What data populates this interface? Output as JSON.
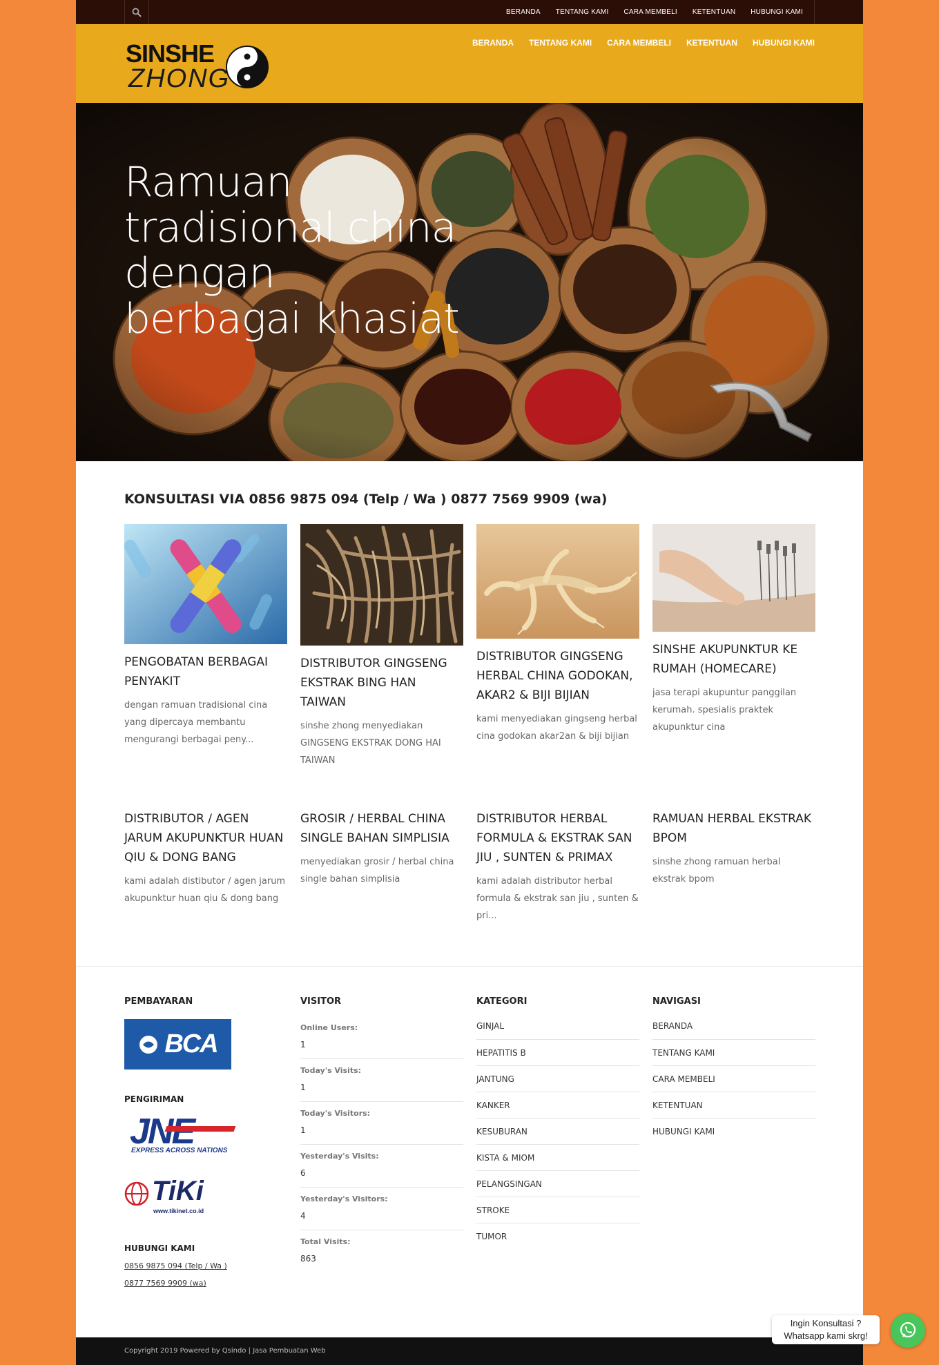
{
  "topbar": {
    "nav": [
      "BERANDA",
      "TENTANG KAMI",
      "CARA MEMBELI",
      "KETENTUAN",
      "HUBUNGI KAMI"
    ]
  },
  "header": {
    "logo_line1": "SINSHE",
    "logo_line2": "ZHONG",
    "nav": [
      "BERANDA",
      "TENTANG KAMI",
      "CARA MEMBELI",
      "KETENTUAN",
      "HUBUNGI KAMI"
    ]
  },
  "hero": {
    "line1": "Ramuan",
    "line2": "tradisional china",
    "line3": "dengan",
    "line4": "berbagai khasiat"
  },
  "consult_heading": "KONSULTASI VIA 0856 9875 094 (Telp / Wa ) 0877 7569 9909 (wa)",
  "services": [
    {
      "title": "PENGOBATAN BERBAGAI PENYAKIT",
      "desc": "dengan ramuan tradisional cina yang dipercaya membantu mengurangi berbagai peny..."
    },
    {
      "title": "DISTRIBUTOR GINGSENG EKSTRAK BING HAN TAIWAN",
      "desc": "sinshe zhong menyediakan GINGSENG EKSTRAK DONG HAI TAIWAN"
    },
    {
      "title": "DISTRIBUTOR GINGSENG HERBAL CHINA GODOKAN, AKAR2 & BIJI BIJIAN",
      "desc": "kami menyediakan gingseng herbal cina godokan akar2an & biji bijian"
    },
    {
      "title": "SINSHE AKUPUNKTUR KE RUMAH (HOMECARE)",
      "desc": "jasa terapi akupuntur panggilan kerumah. spesialis praktek akupunktur cina"
    },
    {
      "title": "DISTRIBUTOR / AGEN JARUM AKUPUNKTUR HUAN QIU & DONG BANG",
      "desc": "kami adalah distibutor / agen jarum akupunktur huan qiu & dong bang"
    },
    {
      "title": "GROSIR / HERBAL CHINA SINGLE BAHAN SIMPLISIA",
      "desc": "menyediakan grosir / herbal china single bahan simplisia"
    },
    {
      "title": "DISTRIBUTOR HERBAL FORMULA & EKSTRAK SAN JIU , SUNTEN & PRIMAX",
      "desc": "kami adalah distributor herbal formula & ekstrak san jiu , sunten & pri..."
    },
    {
      "title": "RAMUAN HERBAL EKSTRAK BPOM",
      "desc": "sinshe zhong ramuan herbal ekstrak bpom"
    }
  ],
  "footer": {
    "payment_title": "PEMBAYARAN",
    "bca_label": "BCA",
    "shipping_title": "PENGIRIMAN",
    "jne_label": "JNE",
    "jne_tagline": "EXPRESS ACROSS NATIONS",
    "tiki_label": "TiKi",
    "tiki_url": "www.tikinet.co.id",
    "contact_title": "HUBUNGI KAMI",
    "contact1": "0856 9875 094 (Telp / Wa )",
    "contact2": "0877 7569 9909 (wa)",
    "visitor_title": "VISITOR",
    "stats": [
      {
        "label": "Online Users:",
        "value": "1"
      },
      {
        "label": "Today's Visits:",
        "value": "1"
      },
      {
        "label": "Today's Visitors:",
        "value": "1"
      },
      {
        "label": "Yesterday's Visits:",
        "value": "6"
      },
      {
        "label": "Yesterday's Visitors:",
        "value": "4"
      },
      {
        "label": "Total Visits:",
        "value": "863"
      }
    ],
    "category_title": "KATEGORI",
    "categories": [
      "GINJAL",
      "HEPATITIS B",
      "JANTUNG",
      "KANKER",
      "KESUBURAN",
      "KISTA & MIOM",
      "PELANGSINGAN",
      "STROKE",
      "TUMOR"
    ],
    "nav_title": "NAVIGASI",
    "nav": [
      "BERANDA",
      "TENTANG KAMI",
      "CARA MEMBELI",
      "KETENTUAN",
      "HUBUNGI KAMI"
    ]
  },
  "copyright": "Copyright 2019 Powered by Qsindo | Jasa Pembuatan Web",
  "whatsapp": {
    "line1": "Ingin Konsultasi ?",
    "line2": "Whatsapp kami skrg!"
  },
  "colors": {
    "page_bg": "#f4883a",
    "header_bg": "#e8a91c",
    "topbar_bg": "#2b0f07",
    "whatsapp": "#49c65a"
  }
}
